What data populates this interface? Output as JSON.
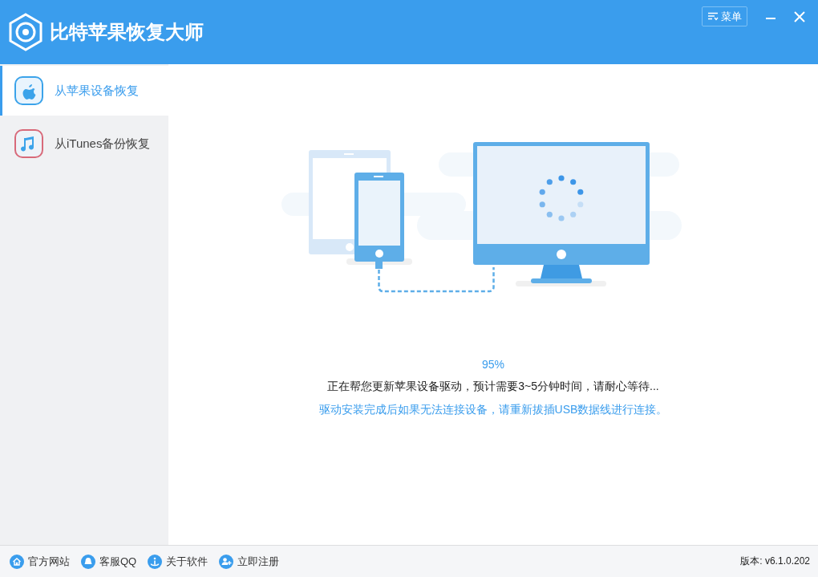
{
  "window": {
    "title": "比特苹果恢复大师",
    "menu_label": "菜单"
  },
  "sidebar": {
    "items": [
      {
        "label": "从苹果设备恢复",
        "selected": true
      },
      {
        "label": "从iTunes备份恢复",
        "selected": false
      }
    ]
  },
  "main": {
    "progress": "95%",
    "message": "正在帮您更新苹果设备驱动，预计需要3~5分钟时间，请耐心等待...",
    "hint": "驱动安装完成后如果无法连接设备，请重新拔插USB数据线进行连接。"
  },
  "footer": {
    "links": [
      {
        "label": "官方网站"
      },
      {
        "label": "客服QQ"
      },
      {
        "label": "关于软件"
      },
      {
        "label": "立即注册"
      }
    ],
    "version": "版本: v6.1.0.202"
  }
}
